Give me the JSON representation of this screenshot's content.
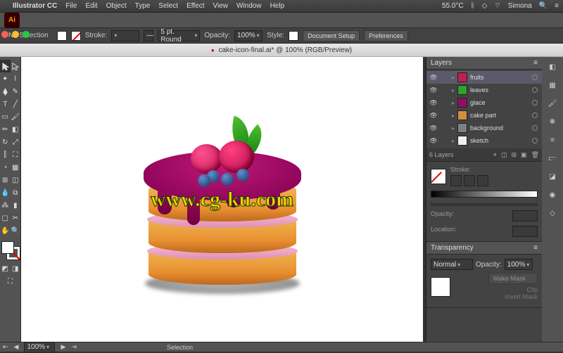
{
  "menubar": {
    "apple": "",
    "app": "Illustrator CC",
    "items": [
      "File",
      "Edit",
      "Object",
      "Type",
      "Select",
      "Effect",
      "View",
      "Window",
      "Help"
    ],
    "temp": "55.0°C",
    "user": "Simona"
  },
  "optbar2": {
    "selection": "No Selection",
    "stroke_label": "Stroke:",
    "stroke_weight": "",
    "brush_label": "5 pt. Round",
    "opacity_label": "Opacity:",
    "opacity_val": "100%",
    "style_label": "Style:",
    "doc_setup": "Document Setup",
    "prefs": "Preferences"
  },
  "doc": {
    "title": "cake-icon-final.ai* @ 100% (RGB/Preview)"
  },
  "watermark": "www.cg-ku.com",
  "layers_panel": {
    "title": "Layers",
    "rows": [
      {
        "name": "fruits",
        "color": "#c02050",
        "sel": true
      },
      {
        "name": "leaves",
        "color": "#30a030"
      },
      {
        "name": "glace",
        "color": "#901060"
      },
      {
        "name": "cake part",
        "color": "#d09040"
      },
      {
        "name": "background",
        "color": "#808080"
      },
      {
        "name": "sketch",
        "color": "#f0f0f0"
      }
    ],
    "footer": "6 Layers"
  },
  "grad_panel": {
    "stroke": "Stroke:",
    "opacity": "Opacity:",
    "location": "Location:"
  },
  "trans_panel": {
    "title": "Transparency",
    "mode": "Normal",
    "opacity_label": "Opacity:",
    "opacity_val": "100%",
    "make_mask": "Make Mask",
    "clip": "Clip",
    "invert": "Invert Mask"
  },
  "status": {
    "zoom": "100%",
    "mode": "Selection"
  },
  "chart_data": null
}
